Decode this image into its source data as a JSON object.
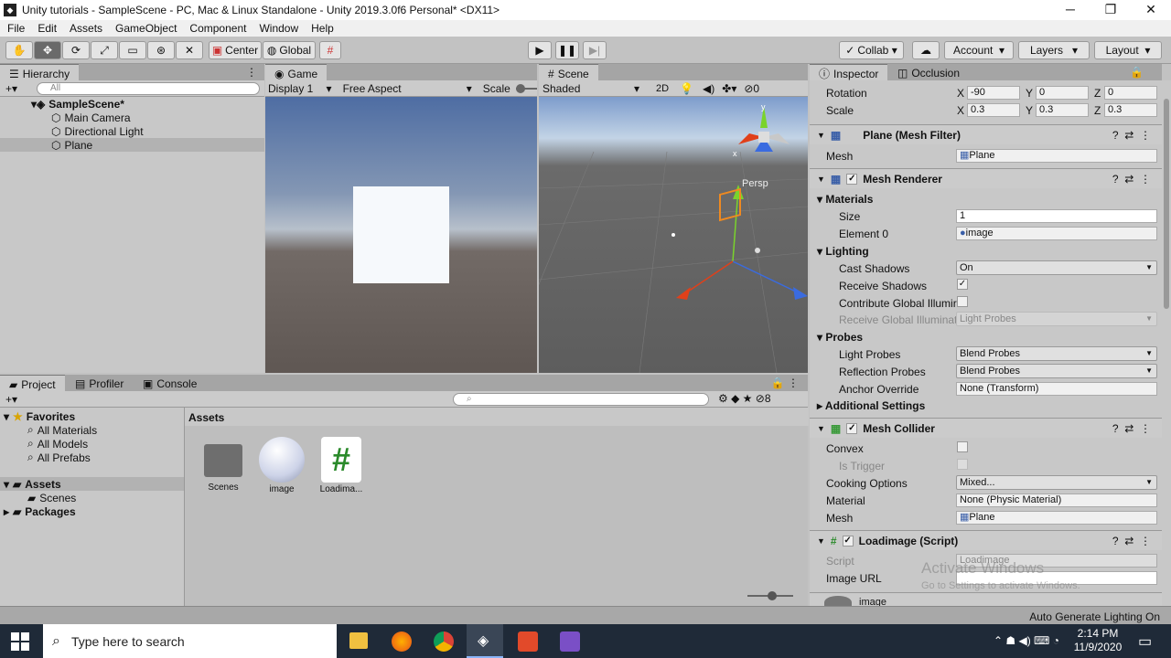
{
  "window": {
    "title": "Unity tutorials - SampleScene - PC, Mac & Linux Standalone - Unity 2019.3.0f6 Personal* <DX11>",
    "minimize": "─",
    "maximize": "❐",
    "close": "✕"
  },
  "menu": [
    "File",
    "Edit",
    "Assets",
    "GameObject",
    "Component",
    "Window",
    "Help"
  ],
  "toolbar": {
    "center": "Center",
    "global": "Global",
    "collab": "Collab",
    "account": "Account",
    "layers": "Layers",
    "layout": "Layout"
  },
  "hierarchy": {
    "tab": "Hierarchy",
    "search": "All",
    "scene": "SampleScene*",
    "items": [
      "Main Camera",
      "Directional Light",
      "Plane"
    ]
  },
  "game": {
    "tab": "Game",
    "display": "Display 1",
    "aspect": "Free Aspect",
    "scale": "Scale"
  },
  "scene": {
    "tab": "Scene",
    "shading": "Shaded",
    "mode2d": "2D",
    "persp": "Persp",
    "hidden_count": "0"
  },
  "inspector": {
    "tab": "Inspector",
    "tab2": "Occlusion",
    "transform": {
      "rotation": "Rotation",
      "scale": "Scale",
      "x": "X",
      "y": "Y",
      "z": "Z",
      "rot": [
        "-90",
        "0",
        "0"
      ],
      "scl": [
        "0.3",
        "0.3",
        "0.3"
      ]
    },
    "mesh_filter": {
      "title": "Plane (Mesh Filter)",
      "mesh_label": "Mesh",
      "mesh": "Plane"
    },
    "mesh_renderer": {
      "title": "Mesh Renderer",
      "materials": "Materials",
      "size_label": "Size",
      "size": "1",
      "element_label": "Element 0",
      "element": "image",
      "lighting": "Lighting",
      "cast_label": "Cast Shadows",
      "cast": "On",
      "receive_label": "Receive Shadows",
      "contribute_label": "Contribute Global Illumir",
      "receive_gi_label": "Receive Global Illuminati",
      "receive_gi": "Light Probes",
      "probes": "Probes",
      "light_probes_label": "Light Probes",
      "light_probes": "Blend Probes",
      "reflection_label": "Reflection Probes",
      "reflection": "Blend Probes",
      "anchor_label": "Anchor Override",
      "anchor": "None (Transform)",
      "additional": "Additional Settings"
    },
    "mesh_collider": {
      "title": "Mesh Collider",
      "convex": "Convex",
      "trigger": "Is Trigger",
      "cooking_label": "Cooking Options",
      "cooking": "Mixed...",
      "material_label": "Material",
      "material": "None (Physic Material)",
      "mesh_label": "Mesh",
      "mesh": "Plane"
    },
    "script": {
      "title": "Loadimage (Script)",
      "script_label": "Script",
      "script": "Loadimage",
      "url_label": "Image URL",
      "url": ""
    },
    "material_preview": "image",
    "watermark1": "Activate Windows",
    "watermark2": "Go to Settings to activate Windows."
  },
  "project": {
    "tabs": [
      "Project",
      "Profiler",
      "Console"
    ],
    "favorites": "Favorites",
    "fav_items": [
      "All Materials",
      "All Models",
      "All Prefabs"
    ],
    "assets": "Assets",
    "scenes": "Scenes",
    "packages": "Packages",
    "breadcrumb": "Assets",
    "asset_items": [
      "Scenes",
      "image",
      "Loadima..."
    ],
    "hidden": "8"
  },
  "status": "Auto Generate Lighting On",
  "taskbar": {
    "search": "Type here to search",
    "time": "2:14 PM",
    "date": "11/9/2020"
  }
}
